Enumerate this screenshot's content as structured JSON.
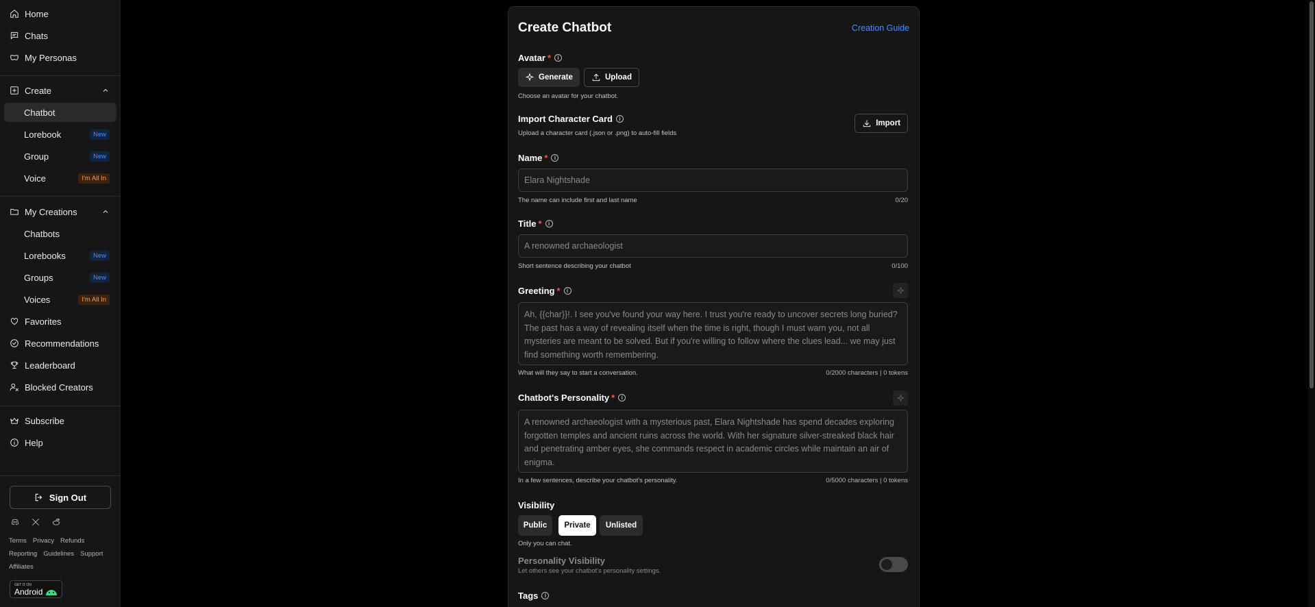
{
  "sidebar": {
    "nav": [
      {
        "label": "Home",
        "icon": "home-icon"
      },
      {
        "label": "Chats",
        "icon": "chat-icon"
      },
      {
        "label": "My Personas",
        "icon": "mask-icon"
      }
    ],
    "create": {
      "label": "Create",
      "items": [
        {
          "label": "Chatbot",
          "badge": ""
        },
        {
          "label": "Lorebook",
          "badge": "New"
        },
        {
          "label": "Group",
          "badge": "New"
        },
        {
          "label": "Voice",
          "badge": "I'm All In"
        }
      ]
    },
    "my_creations": {
      "label": "My Creations",
      "items": [
        {
          "label": "Chatbots",
          "badge": ""
        },
        {
          "label": "Lorebooks",
          "badge": "New"
        },
        {
          "label": "Groups",
          "badge": "New"
        },
        {
          "label": "Voices",
          "badge": "I'm All In"
        }
      ]
    },
    "bottom_nav": [
      {
        "label": "Favorites",
        "icon": "heart-icon"
      },
      {
        "label": "Recommendations",
        "icon": "check-circle-icon"
      },
      {
        "label": "Leaderboard",
        "icon": "trophy-icon"
      },
      {
        "label": "Blocked Creators",
        "icon": "user-block-icon"
      }
    ],
    "extra_nav": [
      {
        "label": "Subscribe",
        "icon": "crown-icon"
      },
      {
        "label": "Help",
        "icon": "info-icon"
      }
    ],
    "sign_out": "Sign Out",
    "footer_row1": [
      "Terms",
      "Privacy",
      "Refunds"
    ],
    "footer_row2": [
      "Reporting",
      "Guidelines",
      "Support"
    ],
    "footer_row3": [
      "Affiliates"
    ],
    "android_small": "GET IT ON",
    "android_big": "Android"
  },
  "form": {
    "title": "Create Chatbot",
    "guide": "Creation Guide",
    "avatar": {
      "label": "Avatar",
      "generate": "Generate",
      "upload": "Upload",
      "hint": "Choose an avatar for your chatbot."
    },
    "import": {
      "label": "Import Character Card",
      "hint": "Upload a character card (.json or .png) to auto-fill fields",
      "button": "Import"
    },
    "name": {
      "label": "Name",
      "placeholder": "Elara Nightshade",
      "hint": "The name can include first and last name",
      "count": "0/20"
    },
    "title_field": {
      "label": "Title",
      "placeholder": "A renowned archaeologist",
      "hint": "Short sentence describing your chatbot",
      "count": "0/100"
    },
    "greeting": {
      "label": "Greeting",
      "placeholder": "Ah, {{char}}!. I see you've found your way here. I trust you're ready to uncover secrets long buried? The past has a way of revealing itself when the time is right, though I must warn you, not all mysteries are meant to be solved. But if you're willing to follow where the clues lead... we may just find something worth remembering.",
      "hint": "What will they say to start a conversation.",
      "count": "0/2000 characters | 0 tokens"
    },
    "personality": {
      "label": "Chatbot's Personality",
      "placeholder": "A renowned archaeologist with a mysterious past, Elara Nightshade has spend decades exploring forgotten temples and ancient ruins across the world. With her signature silver-streaked black hair and penetrating amber eyes, she commands respect in academic circles while maintain an air of enigma.",
      "hint": "In a few sentences, describe your chatbot's personality.",
      "count": "0/5000 characters | 0 tokens"
    },
    "visibility": {
      "label": "Visibility",
      "options": [
        "Public",
        "Private",
        "Unlisted"
      ],
      "selected": "Private",
      "hint": "Only you can chat."
    },
    "personality_visibility": {
      "label": "Personality Visibility",
      "hint": "Let others see your chatbot's personality settings.",
      "enabled": false
    },
    "tags": {
      "label": "Tags"
    }
  },
  "colors": {
    "accent": "#4a8dff",
    "required": "#ff4d4d",
    "badge_new": "#4a8dff",
    "badge_allin": "#ff9a3d"
  }
}
